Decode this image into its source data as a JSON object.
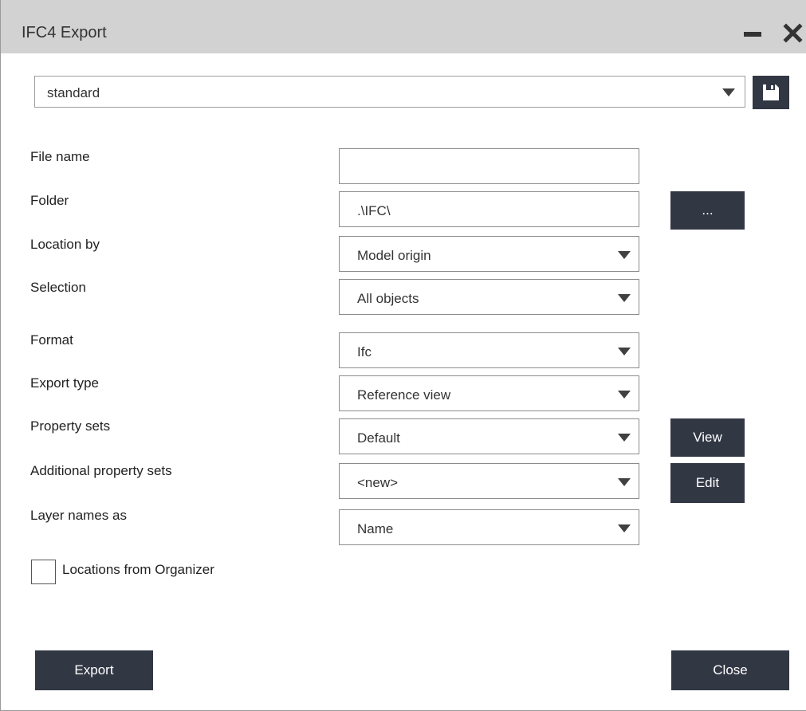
{
  "window": {
    "title": "IFC4 Export"
  },
  "preset": {
    "value": "standard"
  },
  "form": {
    "file_name": {
      "label": "File name",
      "value": ""
    },
    "folder": {
      "label": "Folder",
      "value": ".\\IFC\\",
      "browse_label": "..."
    },
    "location_by": {
      "label": "Location by",
      "value": "Model origin"
    },
    "selection": {
      "label": "Selection",
      "value": "All objects"
    },
    "format": {
      "label": "Format",
      "value": "Ifc"
    },
    "export_type": {
      "label": "Export type",
      "value": "Reference view"
    },
    "property_sets": {
      "label": "Property sets",
      "value": "Default",
      "button_label": "View"
    },
    "additional_property_sets": {
      "label": "Additional property sets",
      "value": "<new>",
      "button_label": "Edit"
    },
    "layer_names_as": {
      "label": "Layer names as",
      "value": "Name"
    }
  },
  "options": {
    "locations_from_organizer": {
      "label": "Locations from Organizer",
      "checked": false
    }
  },
  "footer": {
    "export_label": "Export",
    "close_label": "Close"
  },
  "colors": {
    "titlebar": "#d2d2d2",
    "button_bg": "#323744",
    "button_text": "#ffffff"
  }
}
